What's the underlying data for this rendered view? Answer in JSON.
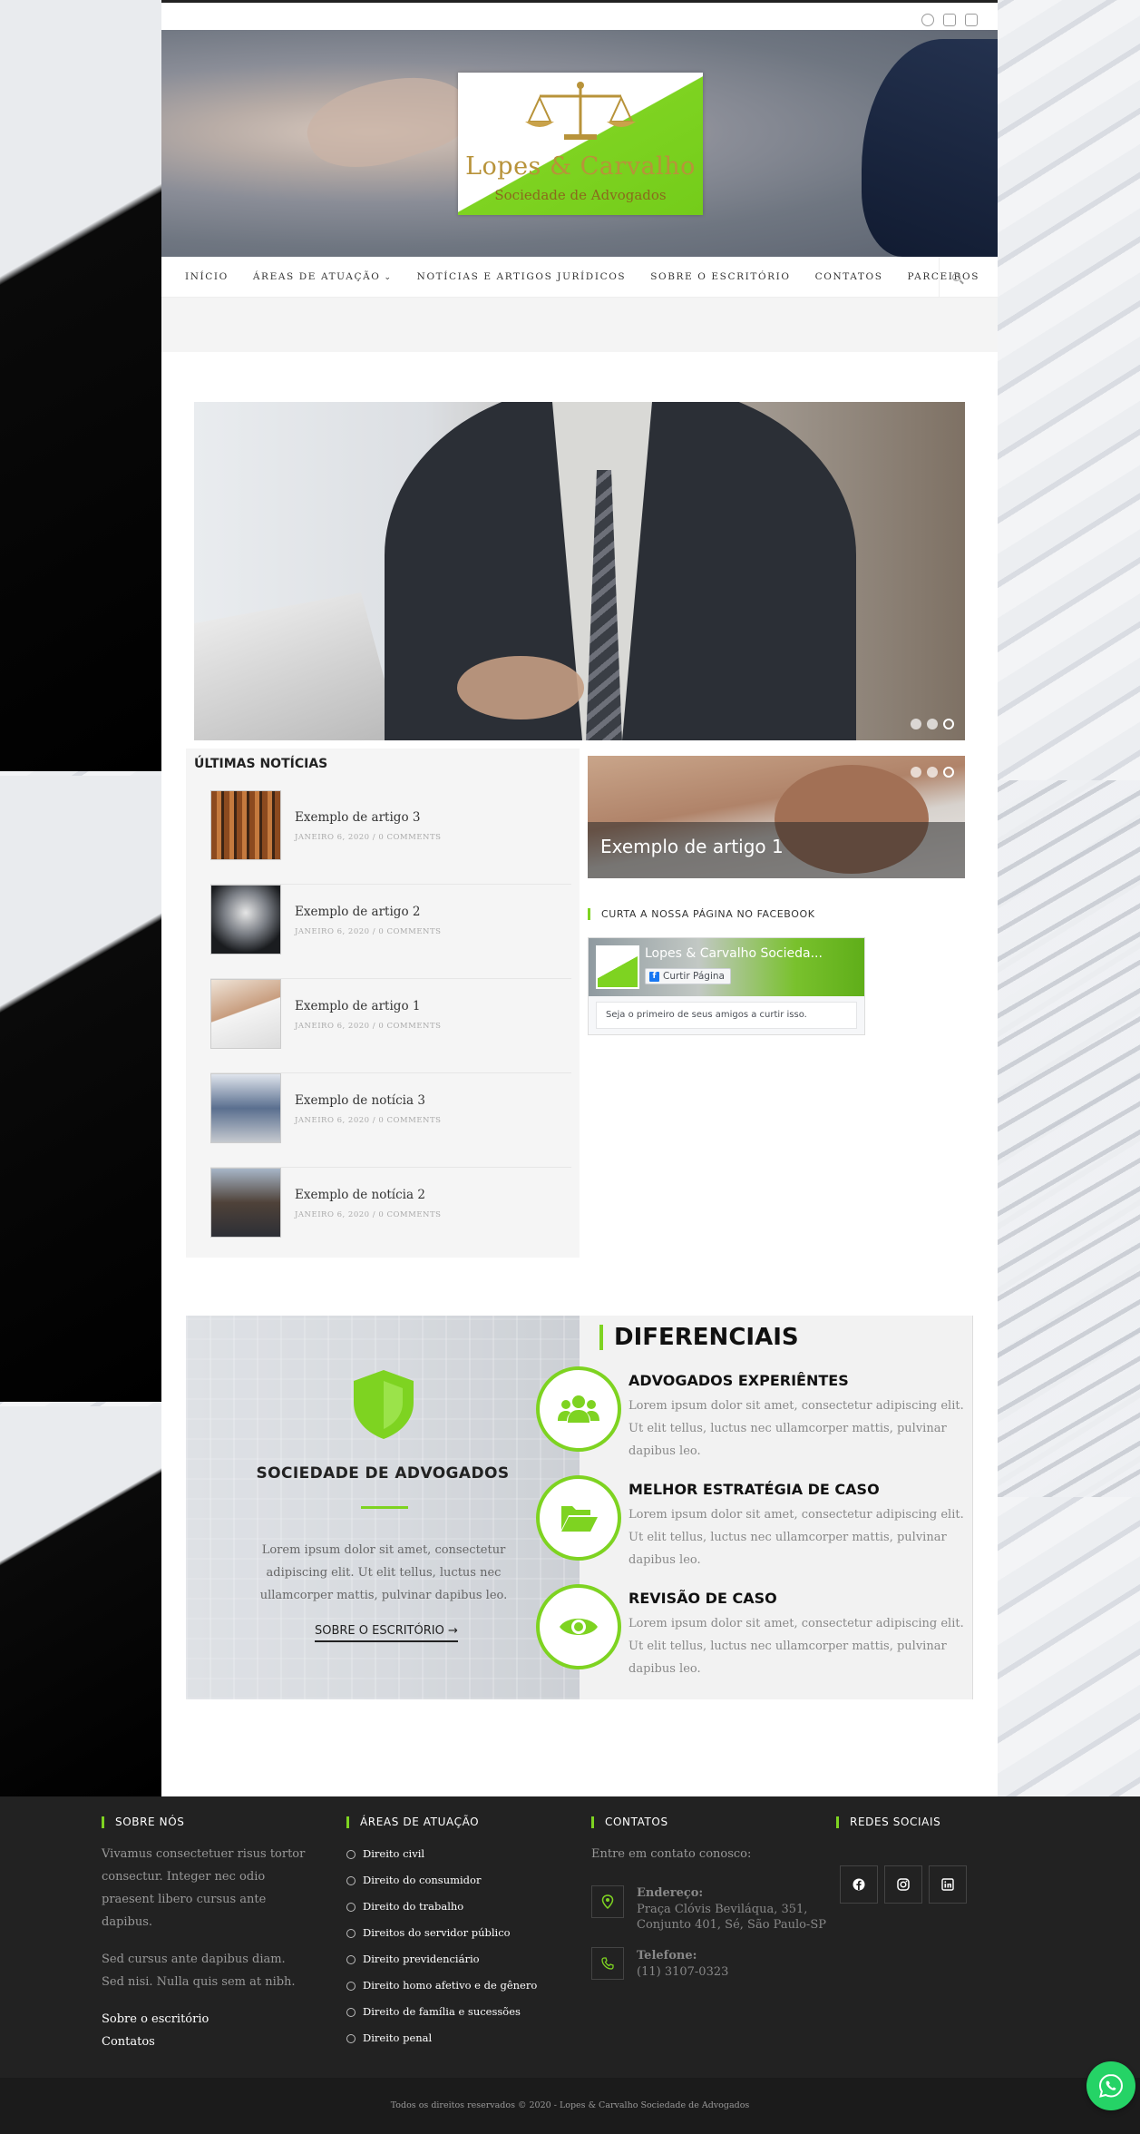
{
  "colors": {
    "accent": "#7ed321",
    "footer_bg": "#222222",
    "whatsapp": "#25d366"
  },
  "topbar": {
    "social_icons": [
      "facebook-icon",
      "instagram-icon",
      "linkedin-icon"
    ]
  },
  "logo": {
    "name": "Lopes & Carvalho",
    "subtitle": "Sociedade de Advogados"
  },
  "nav": {
    "items": [
      "INÍCIO",
      "ÁREAS DE ATUAÇÃO",
      "NOTÍCIAS E ARTIGOS JURÍDICOS",
      "SOBRE O ESCRITÓRIO",
      "CONTATOS",
      "PARCEIROS"
    ],
    "search_icon": "search-icon"
  },
  "main_slider": {
    "slides": 3,
    "active_index": 2
  },
  "news": {
    "title": "ÚLTIMAS NOTÍCIAS",
    "items": [
      {
        "title": "Exemplo de artigo 3",
        "date": "JANEIRO 6, 2020",
        "comments": "0 COMMENTS"
      },
      {
        "title": "Exemplo de artigo 2",
        "date": "JANEIRO 6, 2020",
        "comments": "0 COMMENTS"
      },
      {
        "title": "Exemplo de artigo 1",
        "date": "JANEIRO 6, 2020",
        "comments": "0 COMMENTS"
      },
      {
        "title": "Exemplo de notícia 3",
        "date": "JANEIRO 6, 2020",
        "comments": "0 COMMENTS"
      },
      {
        "title": "Exemplo de notícia 2",
        "date": "JANEIRO 6, 2020",
        "comments": "0 COMMENTS"
      }
    ],
    "meta_separator": "/"
  },
  "mini_slider": {
    "caption": "Exemplo de artigo 1",
    "slides": 3,
    "active_index": 2
  },
  "facebook": {
    "title": "CURTA A NOSSA PÁGINA NO FACEBOOK",
    "page_name": "Lopes & Carvalho Socieda...",
    "like_label": "Curtir Página",
    "friends_text": "Seja o primeiro de seus amigos a curtir isso."
  },
  "sociedade": {
    "title": "SOCIEDADE DE ADVOGADOS",
    "text": "Lorem ipsum dolor sit amet, consectetur adipiscing elit. Ut elit tellus, luctus nec ullamcorper mattis, pulvinar dapibus leo.",
    "link": "SOBRE O ESCRITÓRIO",
    "link_arrow": "→"
  },
  "diferenciais": {
    "title": "DIFERENCIAIS",
    "features": [
      {
        "title": "ADVOGADOS EXPERIÊNTES",
        "text": "Lorem ipsum dolor sit amet, consectetur adipiscing elit. Ut elit tellus, luctus nec ullamcorper mattis, pulvinar dapibus leo.",
        "icon": "users-icon"
      },
      {
        "title": "MELHOR ESTRATÉGIA DE CASO",
        "text": "Lorem ipsum dolor sit amet, consectetur adipiscing elit. Ut elit tellus, luctus nec ullamcorper mattis, pulvinar dapibus leo.",
        "icon": "folder-open-icon"
      },
      {
        "title": "REVISÃO DE CASO",
        "text": "Lorem ipsum dolor sit amet, consectetur adipiscing elit. Ut elit tellus, luctus nec ullamcorper mattis, pulvinar dapibus leo.",
        "icon": "eye-icon"
      }
    ]
  },
  "footer": {
    "about": {
      "title": "SOBRE NÓS",
      "p1": "Vivamus consectetuer risus tortor consectur. Integer nec odio praesent libero cursus ante dapibus.",
      "p2": "Sed cursus ante dapibus diam. Sed nisi. Nulla quis sem at nibh.",
      "links": [
        "Sobre o escritório",
        "Contatos"
      ]
    },
    "areas": {
      "title": "ÁREAS DE ATUAÇÃO",
      "items": [
        "Direito civil",
        "Direito do consumidor",
        "Direito do trabalho",
        "Direitos do servidor público",
        "Direito previdenciário",
        "Direito homo afetivo e de gênero",
        "Direito de família e sucessões",
        "Direito penal"
      ]
    },
    "contacts": {
      "title": "CONTATOS",
      "intro": "Entre em contato conosco:",
      "address_label": "Endereço:",
      "address_line1": "Praça Clóvis Beviláqua, 351,",
      "address_line2": "Conjunto 401, Sé, São Paulo-SP",
      "phone_label": "Telefone:",
      "phone": "(11) 3107-0323"
    },
    "social": {
      "title": "REDES SOCIAIS",
      "icons": [
        "facebook-icon",
        "instagram-icon",
        "linkedin-icon"
      ]
    }
  },
  "copyright": "Todos os direitos reservados © 2020 - Lopes & Carvalho Sociedade de Advogados"
}
